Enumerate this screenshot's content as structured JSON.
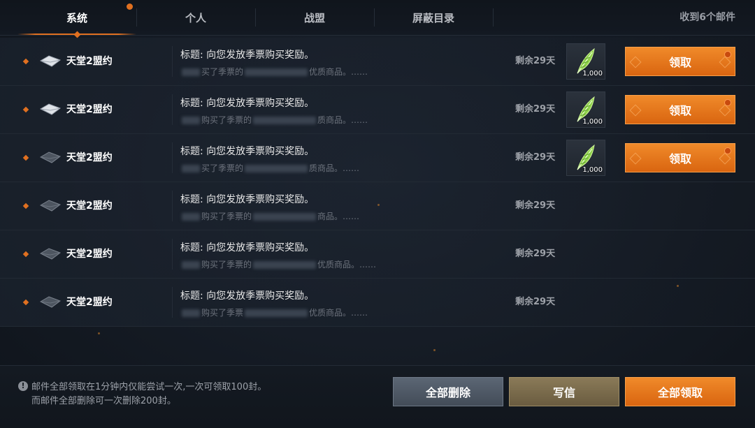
{
  "tabs": [
    {
      "label": "系统",
      "active": true,
      "has_notice": true
    },
    {
      "label": "个人",
      "active": false,
      "has_notice": false
    },
    {
      "label": "战盟",
      "active": false,
      "has_notice": false
    },
    {
      "label": "屏蔽目录",
      "active": false,
      "has_notice": false
    }
  ],
  "mail_count_label": "收到6个邮件",
  "mails": [
    {
      "sender": "天堂2盟约",
      "subject": "标题: 向您发放季票购买奖励。",
      "preview_parts": [
        "买了季票的",
        "优质商品。……"
      ],
      "days_left": "剩余29天",
      "envelope_icon": "envelope-open-icon",
      "reward": {
        "icon": "green-feather-icon",
        "quantity": "1,000"
      },
      "claim_label": "领取"
    },
    {
      "sender": "天堂2盟约",
      "subject": "标题: 向您发放季票购买奖励。",
      "preview_parts": [
        "购买了季票的",
        "质商品。……"
      ],
      "days_left": "剩余29天",
      "envelope_icon": "envelope-open-icon",
      "reward": {
        "icon": "green-feather-icon",
        "quantity": "1,000"
      },
      "claim_label": "领取"
    },
    {
      "sender": "天堂2盟约",
      "subject": "标题: 向您发放季票购买奖励。",
      "preview_parts": [
        "买了季票的",
        "质商品。……"
      ],
      "days_left": "剩余29天",
      "envelope_icon": "envelope-closed-icon",
      "reward": {
        "icon": "green-feather-icon",
        "quantity": "1,000"
      },
      "claim_label": "领取"
    },
    {
      "sender": "天堂2盟约",
      "subject": "标题: 向您发放季票购买奖励。",
      "preview_parts": [
        "购买了季票的",
        "商品。……"
      ],
      "days_left": "剩余29天",
      "envelope_icon": "envelope-closed-icon",
      "reward": null,
      "claim_label": null
    },
    {
      "sender": "天堂2盟约",
      "subject": "标题: 向您发放季票购买奖励。",
      "preview_parts": [
        "购买了季票的",
        "优质商品。……"
      ],
      "days_left": "剩余29天",
      "envelope_icon": "envelope-closed-icon",
      "reward": null,
      "claim_label": null
    },
    {
      "sender": "天堂2盟约",
      "subject": "标题: 向您发放季票购买奖励。",
      "preview_parts": [
        "购买了季票",
        "优质商品。……"
      ],
      "days_left": "剩余29天",
      "envelope_icon": "envelope-closed-icon",
      "reward": null,
      "claim_label": null
    }
  ],
  "footer": {
    "notice_lines": [
      "邮件全部领取在1分钟内仅能尝试一次,一次可领取100封。",
      "而邮件全部删除可一次删除200封。"
    ],
    "delete_all_label": "全部删除",
    "write_label": "写信",
    "claim_all_label": "全部领取"
  },
  "colors": {
    "accent": "#e07020",
    "background": "#141a23",
    "delete_button": "#4f5966",
    "write_button": "#7a6b4c"
  }
}
